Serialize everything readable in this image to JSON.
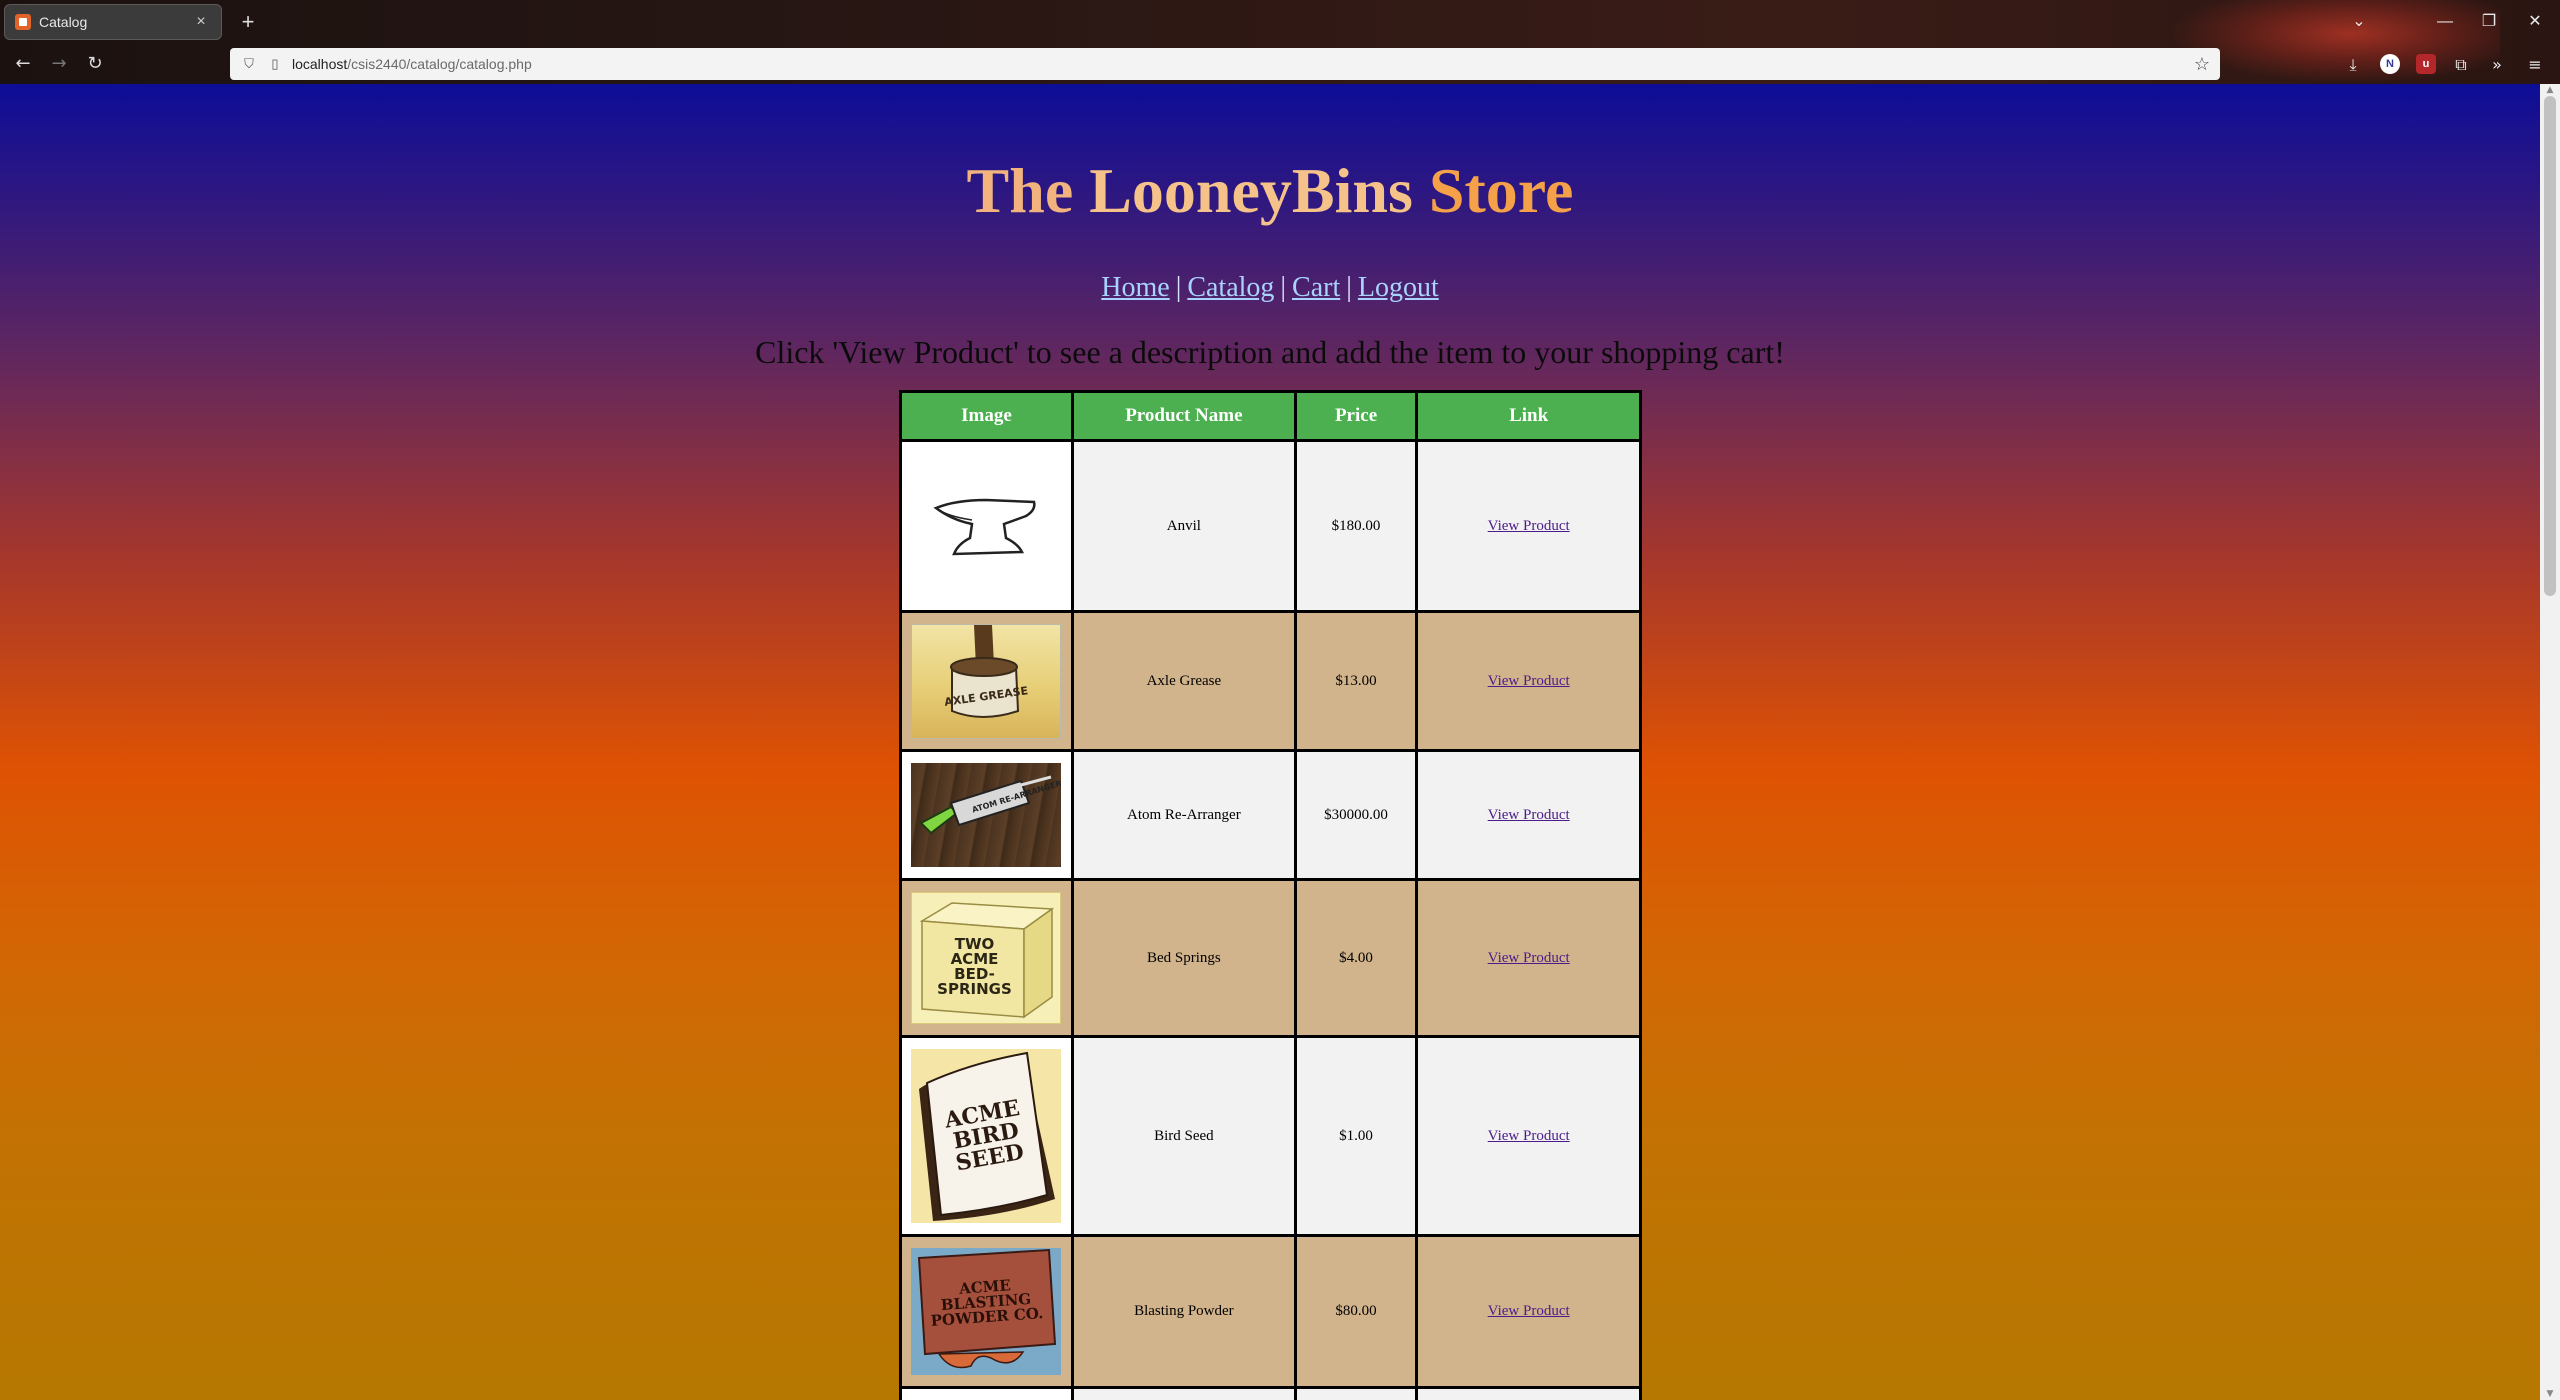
{
  "browser": {
    "tab_title": "Catalog",
    "tab_close": "×",
    "new_tab": "+",
    "url_host": "localhost",
    "url_path": "/csis2440/catalog/catalog.php",
    "window_controls": [
      "⌄",
      "—",
      "❐",
      "✕"
    ]
  },
  "site": {
    "title_words": [
      "The",
      "LooneyBins",
      "Store"
    ],
    "title_colors": [
      "#f2b37f",
      "#f5c28a",
      "#f4a14a"
    ],
    "nav": [
      {
        "label": "Home"
      },
      {
        "label": "Catalog"
      },
      {
        "label": "Cart"
      },
      {
        "label": "Logout"
      }
    ],
    "nav_separator": "|",
    "instructions": "Click 'View Product' to see a description and add the item to your shopping cart!"
  },
  "table": {
    "headers": [
      "Image",
      "Product Name",
      "Price",
      "Link"
    ],
    "header_color": "#4cb050",
    "row_colors": [
      "#f2f2f2",
      "#d2b48c"
    ],
    "rows": [
      {
        "name": "Anvil",
        "price": "$180.00",
        "link": "View Product",
        "image": "anvil-icon"
      },
      {
        "name": "Axle Grease",
        "price": "$13.00",
        "link": "View Product",
        "image": "axle-grease-image",
        "image_text": "AXLE GREASE"
      },
      {
        "name": "Atom Re-Arranger",
        "price": "$30000.00",
        "link": "View Product",
        "image": "atom-rearranger-image"
      },
      {
        "name": "Bed Springs",
        "price": "$4.00",
        "link": "View Product",
        "image": "bed-springs-image",
        "image_text": "TWO ACME BED-SPRINGS"
      },
      {
        "name": "Bird Seed",
        "price": "$1.00",
        "link": "View Product",
        "image": "bird-seed-image",
        "image_text": "ACME BIRD SEED"
      },
      {
        "name": "Blasting Powder",
        "price": "$80.00",
        "link": "View Product",
        "image": "blasting-powder-image",
        "image_text": "ACME BLASTING POWDER CO."
      }
    ]
  }
}
